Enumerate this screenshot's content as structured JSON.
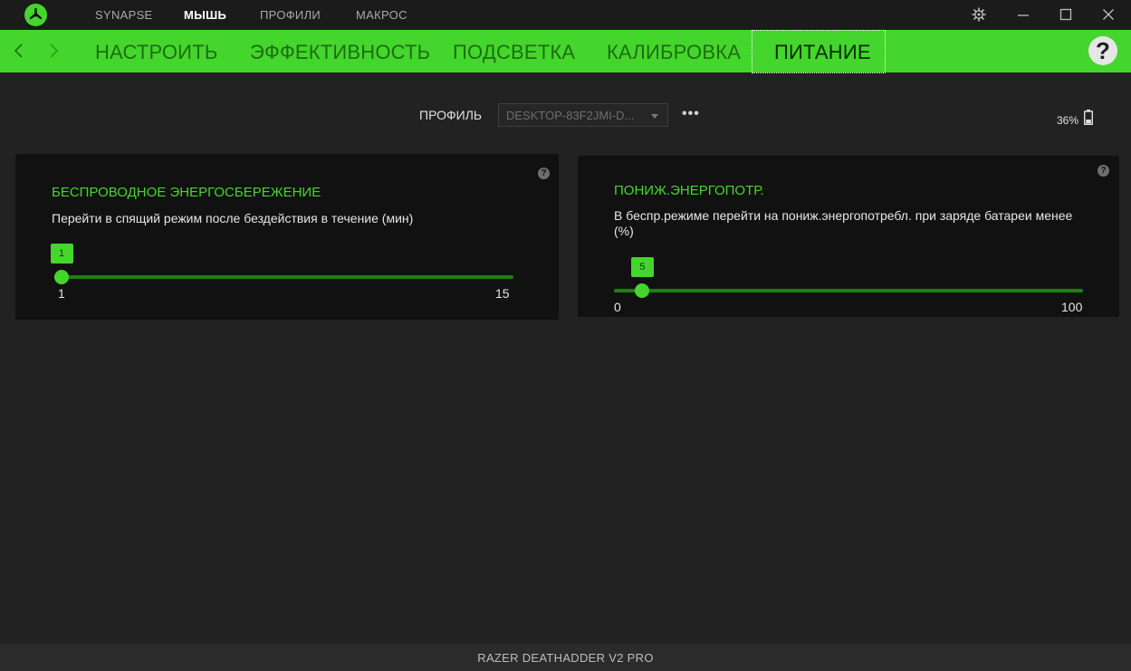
{
  "topnav": {
    "items": [
      "SYNAPSE",
      "МЫШЬ",
      "ПРОФИЛИ",
      "МАКРОС"
    ],
    "active_index": 1
  },
  "subnav": {
    "tabs": [
      "НАСТРОИТЬ",
      "ЭФФЕКТИВНОСТЬ",
      "ПОДСВЕТКА",
      "КАЛИБРОВКА",
      "ПИТАНИЕ"
    ],
    "active_index": 4,
    "help_label": "?"
  },
  "profile": {
    "label": "ПРОФИЛЬ",
    "selected": "DESKTOP-83F2JMI-D...",
    "more_label": "•••"
  },
  "battery": {
    "percent_text": "36%",
    "level_fraction": 0.36
  },
  "cards": {
    "wireless": {
      "title": "БЕСПРОВОДНОЕ ЭНЕРГОСБЕРЕЖЕНИЕ",
      "description": "Перейти в спящий режим после бездействия в течение (мин)",
      "help": "?",
      "slider": {
        "value": 1,
        "min": 1,
        "max": 15,
        "value_label": "1",
        "min_label": "1",
        "max_label": "15"
      }
    },
    "low_power": {
      "title": "ПОНИЖ.ЭНЕРГОПОТР.",
      "description": "В беспр.режиме перейти на пониж.энергопотребл. при заряде батареи менее (%)",
      "help": "?",
      "slider": {
        "value": 5,
        "min": 0,
        "max": 100,
        "value_label": "5",
        "min_label": "0",
        "max_label": "100"
      }
    }
  },
  "footer": {
    "device_name": "RAZER DEATHADDER V2 PRO"
  },
  "colors": {
    "accent": "#44d62c",
    "track": "#1f7f12",
    "background": "#222222",
    "card": "#111111"
  }
}
